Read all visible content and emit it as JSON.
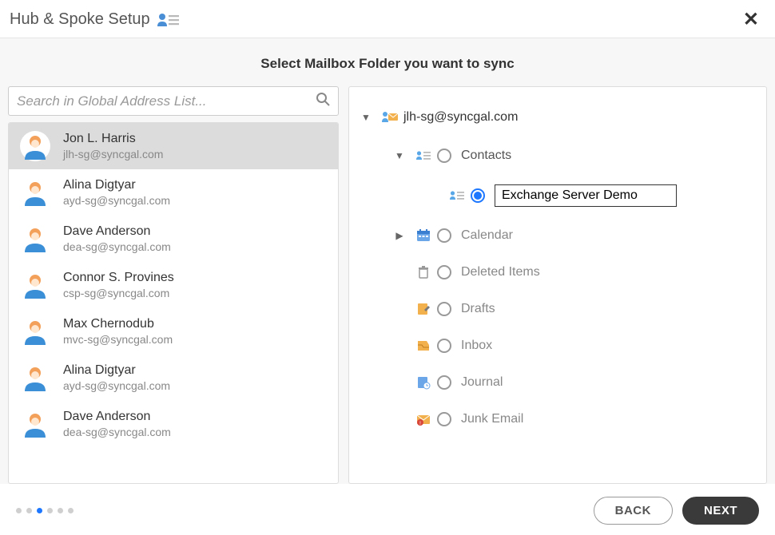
{
  "header": {
    "title": "Hub & Spoke Setup"
  },
  "subtitle": "Select Mailbox Folder you want to sync",
  "search": {
    "placeholder": "Search in Global Address List..."
  },
  "contacts": [
    {
      "name": "Jon L. Harris",
      "email": "jlh-sg@syncgal.com",
      "selected": true
    },
    {
      "name": "Alina Digtyar",
      "email": "ayd-sg@syncgal.com",
      "selected": false
    },
    {
      "name": "Dave Anderson",
      "email": "dea-sg@syncgal.com",
      "selected": false
    },
    {
      "name": "Connor S. Provines",
      "email": "csp-sg@syncgal.com",
      "selected": false
    },
    {
      "name": "Max Chernodub",
      "email": "mvc-sg@syncgal.com",
      "selected": false
    },
    {
      "name": "Alina Digtyar",
      "email": "ayd-sg@syncgal.com",
      "selected": false
    },
    {
      "name": "Dave Anderson",
      "email": "dea-sg@syncgal.com",
      "selected": false
    }
  ],
  "tree": {
    "mailbox": "jlh-sg@syncgal.com",
    "contacts_label": "Contacts",
    "selected_folder_value": "Exchange Server Demo",
    "folders": [
      {
        "label": "Calendar",
        "icon": "calendar",
        "expandable": true
      },
      {
        "label": "Deleted Items",
        "icon": "trash",
        "expandable": false
      },
      {
        "label": "Drafts",
        "icon": "drafts",
        "expandable": false
      },
      {
        "label": "Inbox",
        "icon": "inbox",
        "expandable": false
      },
      {
        "label": "Journal",
        "icon": "journal",
        "expandable": false
      },
      {
        "label": "Junk Email",
        "icon": "junk",
        "expandable": false
      }
    ]
  },
  "wizard": {
    "total_steps": 6,
    "current_step": 3
  },
  "buttons": {
    "back": "BACK",
    "next": "NEXT"
  }
}
